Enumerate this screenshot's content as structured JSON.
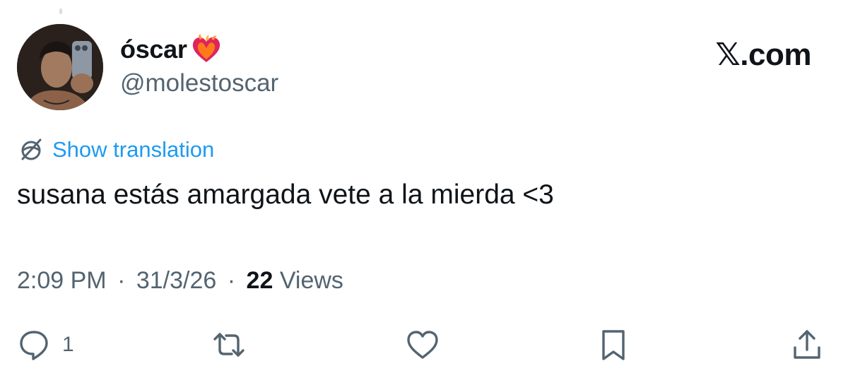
{
  "colors": {
    "link": "#1d9bf0",
    "secondary_text": "#536471",
    "primary_text": "#0f1419"
  },
  "author": {
    "display_name": "óscar",
    "name_emoji": "heart-on-fire-icon",
    "handle": "@molestoscar"
  },
  "brand": {
    "label": "𝕏.com"
  },
  "translation": {
    "icon": "translate-globe-icon",
    "label": "Show translation"
  },
  "tweet": {
    "text": "susana estás amargada vete a la mierda <3"
  },
  "meta": {
    "time": "2:09 PM",
    "separator": "·",
    "date": "31/3/26",
    "views_count": "22",
    "views_label": "Views"
  },
  "actions": {
    "reply": {
      "icon": "reply-icon",
      "count": "1"
    },
    "retweet": {
      "icon": "retweet-icon"
    },
    "like": {
      "icon": "heart-icon"
    },
    "bookmark": {
      "icon": "bookmark-icon"
    },
    "share": {
      "icon": "share-icon"
    }
  }
}
